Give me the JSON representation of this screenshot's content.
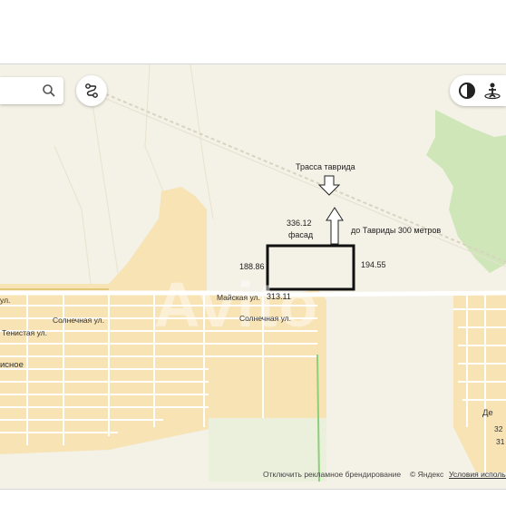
{
  "map": {
    "highway_label": "Трасса таврида",
    "distance_label": "до Тавриды 300 метров",
    "plot": {
      "facade_value": "336.12",
      "facade_word": "фасад",
      "left_side": "188.86",
      "right_side": "194.55",
      "bottom_side": "313.11"
    },
    "streets": {
      "mayskaya": "Майская ул.",
      "solnechnaya_left": "Солнечная ул.",
      "solnechnaya_right": "Солнечная ул.",
      "tenistaya": "Тенистая ул.",
      "ul_left": "ул.",
      "village": "исное"
    },
    "edge_labels": {
      "right_de": "Де",
      "right_32": "32",
      "right_31": "31"
    },
    "watermark": "Avito"
  },
  "footer": {
    "ad_text": "Отключить рекламное брендирование",
    "copyright": "© Яндекс",
    "terms": "Условия использ"
  },
  "icons": {
    "search": "search-icon",
    "route": "route-icon",
    "layers": "layers-icon",
    "panorama": "panorama-icon"
  },
  "colors": {
    "map_background": "#f4f1e6",
    "residential": "#f7e3b4",
    "forest": "#cfe6b8",
    "road": "#ffffff",
    "plot_outline": "#111111"
  }
}
